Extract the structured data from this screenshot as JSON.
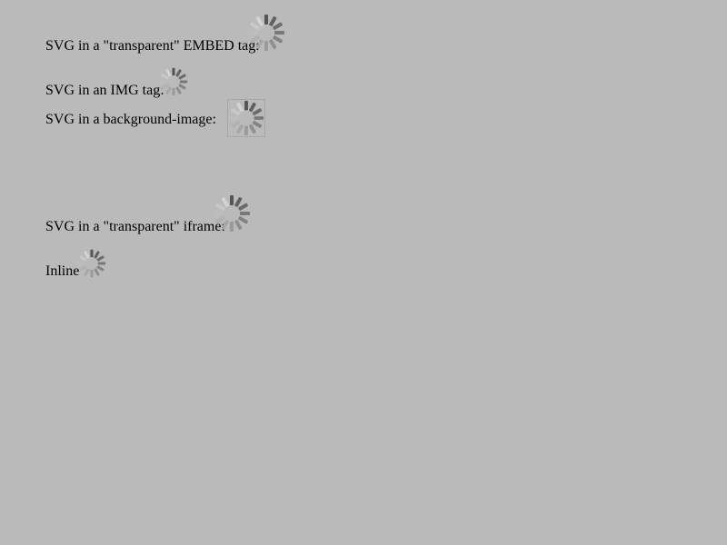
{
  "rows": {
    "embed": {
      "label": "SVG in a \"transparent\" EMBED tag:"
    },
    "img": {
      "label": "SVG in an IMG tag:"
    },
    "background": {
      "label": "SVG in a background-image:"
    },
    "iframe": {
      "label": "SVG in a \"transparent\" iframe:"
    },
    "inline": {
      "label": "Inline"
    }
  },
  "icons": {
    "spinner": "loading-spinner-icon"
  },
  "colors": {
    "page_background": "#bababa",
    "spinner_dark": "#555555",
    "spinner_light": "#d4d4d4",
    "bg_box_border": "#a8a8a8"
  }
}
